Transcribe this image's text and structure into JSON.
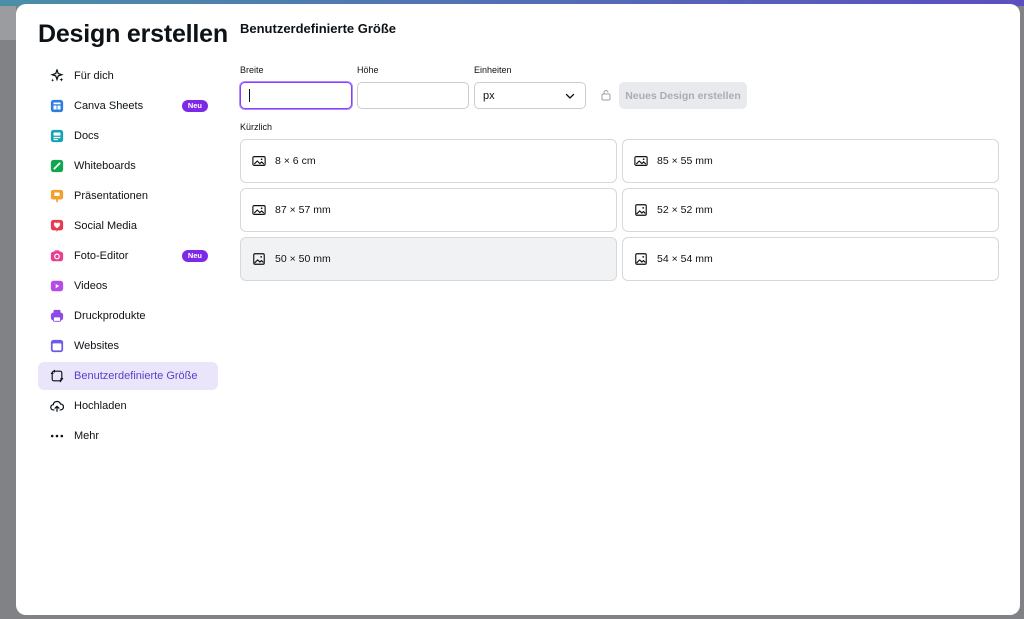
{
  "sidebar": {
    "title": "Design erstellen",
    "items": [
      {
        "label": "Für dich",
        "icon": "sparkle-icon"
      },
      {
        "label": "Canva Sheets",
        "icon": "sheets-icon",
        "badge": "Neu"
      },
      {
        "label": "Docs",
        "icon": "docs-icon"
      },
      {
        "label": "Whiteboards",
        "icon": "whiteboard-icon"
      },
      {
        "label": "Präsentationen",
        "icon": "presentation-icon"
      },
      {
        "label": "Social Media",
        "icon": "heart-icon"
      },
      {
        "label": "Foto-Editor",
        "icon": "camera-icon",
        "badge": "Neu"
      },
      {
        "label": "Videos",
        "icon": "video-icon"
      },
      {
        "label": "Druckprodukte",
        "icon": "printer-icon"
      },
      {
        "label": "Websites",
        "icon": "website-icon"
      },
      {
        "label": "Benutzerdefinierte Größe",
        "icon": "custom-size-icon",
        "active": true
      },
      {
        "label": "Hochladen",
        "icon": "upload-cloud-icon"
      },
      {
        "label": "Mehr",
        "icon": "more-dots-icon"
      }
    ]
  },
  "main": {
    "title": "Benutzerdefinierte Größe",
    "width_label": "Breite",
    "height_label": "Höhe",
    "units_label": "Einheiten",
    "width_value": "",
    "height_value": "",
    "units_value": "px",
    "create_button": "Neues Design erstellen",
    "recent_label": "Kürzlich",
    "recent": [
      {
        "label": "8 × 6 cm",
        "icon": "landscape-image-icon"
      },
      {
        "label": "85 × 55 mm",
        "icon": "landscape-image-icon"
      },
      {
        "label": "87 × 57 mm",
        "icon": "landscape-image-icon"
      },
      {
        "label": "52 × 52 mm",
        "icon": "square-image-icon"
      },
      {
        "label": "50 × 50 mm",
        "icon": "square-image-icon",
        "hover": true
      },
      {
        "label": "54 × 54 mm",
        "icon": "square-image-icon"
      }
    ]
  },
  "colors": {
    "accent": "#8b3dff",
    "active_bg": "#ebe5fb",
    "badge": "#7d2ae8"
  }
}
